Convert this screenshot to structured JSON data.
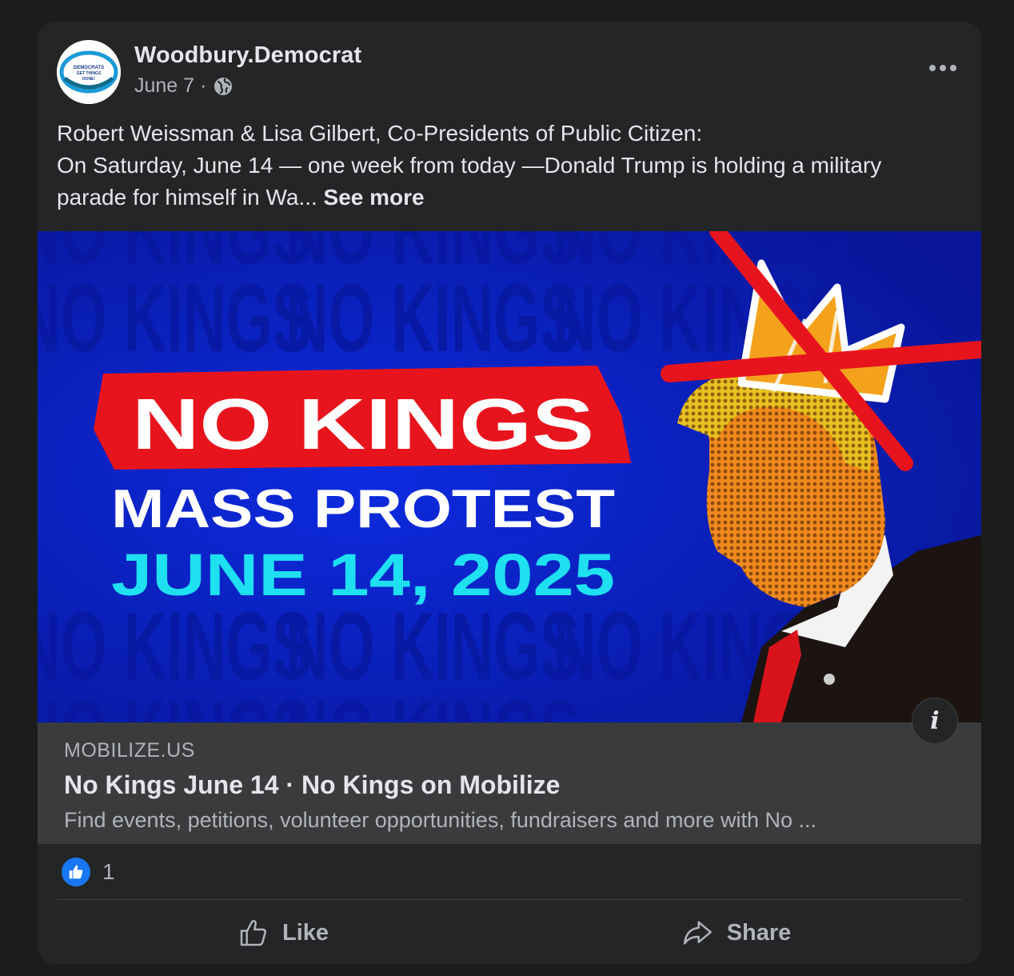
{
  "post": {
    "author": "Woodbury.Democrat",
    "avatar_text": [
      "DEMOCRATS",
      "GET THINGS",
      "DONE!"
    ],
    "date": "June 7",
    "separator": "·",
    "privacy_icon": "globe-icon",
    "more_icon": "more-horizontal-icon",
    "text_lines": [
      "Robert Weissman & Lisa Gilbert, Co-Presidents of Public Citizen:",
      "On Saturday, June 14 — one week from today —Donald Trump is holding a military",
      "parade for himself in Wa... "
    ],
    "see_more": "See more"
  },
  "image": {
    "headline": "NO KINGS",
    "subhead": "MASS PROTEST",
    "date": "JUNE 14, 2025",
    "background_word": "NO KINGS",
    "colors": {
      "background": "#0b1fb8",
      "red": "#e8141d",
      "cyan": "#1ee0f0",
      "white": "#ffffff"
    }
  },
  "link": {
    "domain": "MOBILIZE.US",
    "title": "No Kings June 14 · No Kings on Mobilize",
    "description": "Find events, petitions, volunteer opportunities, fundraisers and more with No ..."
  },
  "info_label": "i",
  "reactions": {
    "count": "1",
    "icon": "like-reaction-icon"
  },
  "actions": {
    "like": "Like",
    "share": "Share"
  }
}
